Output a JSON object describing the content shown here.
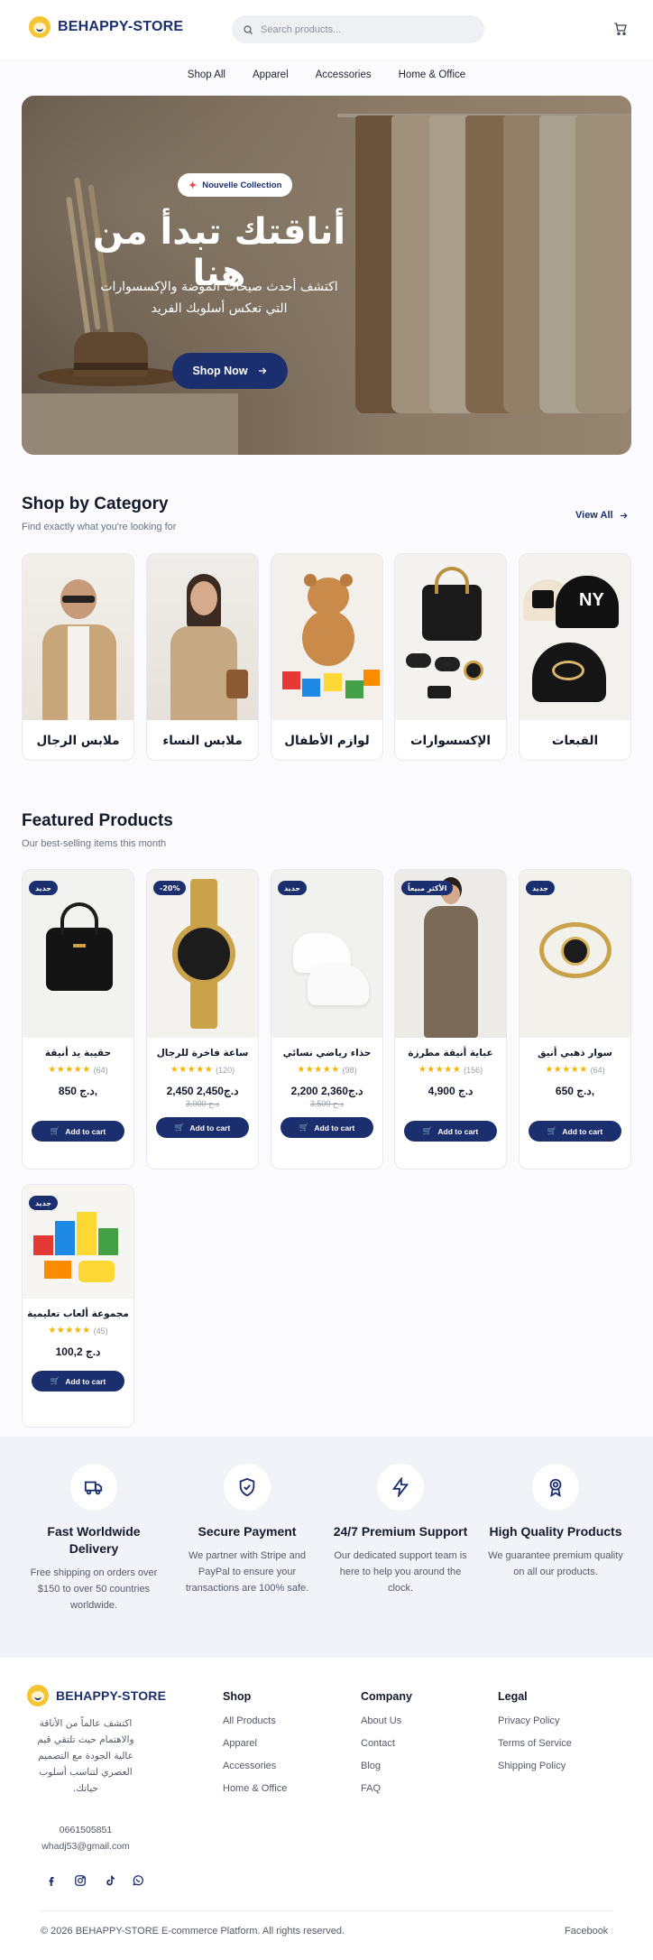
{
  "brand": {
    "name": "BEHAPPY-STORE",
    "accent": "#1b2f6e",
    "star_color": "#f4b400"
  },
  "header": {
    "search_placeholder": "Search products...",
    "cart_icon": "cart-icon"
  },
  "nav": [
    "Shop All",
    "Apparel",
    "Accessories",
    "Home & Office"
  ],
  "hero": {
    "badge": "Nouvelle Collection",
    "title": "أناقتك تبدأ من هنا",
    "subtitle": "اكتشف أحدث صيحات الموضة والإكسسوارات التي تعكس أسلوبك الفريد",
    "cta": "Shop Now"
  },
  "categories": {
    "title": "Shop by Category",
    "subtitle": "Find exactly what you're looking for",
    "view_all": "View All",
    "items": [
      {
        "label": "ملابس الرجال"
      },
      {
        "label": "ملابس النساء"
      },
      {
        "label": "لوازم الأطفال"
      },
      {
        "label": "الإكسسوارات"
      },
      {
        "label": "القبعات"
      }
    ]
  },
  "featured": {
    "title": "Featured Products",
    "subtitle": "Our best-selling items this month",
    "add_label": "Add to cart",
    "products": [
      {
        "badge": "جديد",
        "name": "حقيبة يد أنيقة",
        "rating": 4.5,
        "reviews": "(64)",
        "price": "د.ج 850,",
        "old_price": ""
      },
      {
        "badge": "-20%",
        "name": "ساعة فاخرة للرجال",
        "rating": 4.5,
        "reviews": "(120)",
        "price": "2,450 د.ج2,450",
        "old_price": "د.ج 3,000"
      },
      {
        "badge": "جديد",
        "name": "حذاء رياضي نسائي",
        "rating": 4.5,
        "reviews": "(98)",
        "price": "2,200 د.ج2,360",
        "old_price": "د.ج 3,500"
      },
      {
        "badge": "الأكثر مبيعاً",
        "name": "عباية أنيقة مطرزة",
        "rating": 5,
        "reviews": "(156)",
        "price": "4,900 د.ج",
        "old_price": ""
      },
      {
        "badge": "جديد",
        "name": "سوار ذهبي أنيق",
        "rating": 5,
        "reviews": "(64)",
        "price": "د.ج 650,",
        "old_price": ""
      },
      {
        "badge": "جديد",
        "name": "مجموعة ألعاب تعليمية",
        "rating": 5,
        "reviews": "(45)",
        "price": "د.ج 100,2",
        "old_price": ""
      }
    ]
  },
  "features": [
    {
      "icon": "truck-icon",
      "title": "Fast Worldwide Delivery",
      "desc": "Free shipping on orders over $150 to over 50 countries worldwide."
    },
    {
      "icon": "shield-check-icon",
      "title": "Secure Payment",
      "desc": "We partner with Stripe and PayPal to ensure your transactions are 100% safe."
    },
    {
      "icon": "lightning-icon",
      "title": "24/7 Premium Support",
      "desc": "Our dedicated support team is here to help you around the clock."
    },
    {
      "icon": "award-icon",
      "title": "High Quality Products",
      "desc": "We guarantee premium quality on all our products."
    }
  ],
  "footer": {
    "description": "اكتشف عالماً من الأناقة والاهتمام حيث تلتقي قيم عالية الجودة مع التصميم العصري لتناسب أسلوب حياتك.",
    "phone": "0661505851",
    "email": "whadj53@gmail.com",
    "socials": [
      "facebook-icon",
      "instagram-icon",
      "tiktok-icon",
      "whatsapp-icon"
    ],
    "shop": {
      "title": "Shop",
      "links": [
        "All Products",
        "Apparel",
        "Accessories",
        "Home & Office"
      ]
    },
    "company": {
      "title": "Company",
      "links": [
        "About Us",
        "Contact",
        "Blog",
        "FAQ"
      ]
    },
    "legal": {
      "title": "Legal",
      "links": [
        "Privacy Policy",
        "Terms of Service",
        "Shipping Policy"
      ]
    },
    "copyright": "© 2026 BEHAPPY-STORE E-commerce Platform. All rights reserved.",
    "facebook": "Facebook"
  }
}
